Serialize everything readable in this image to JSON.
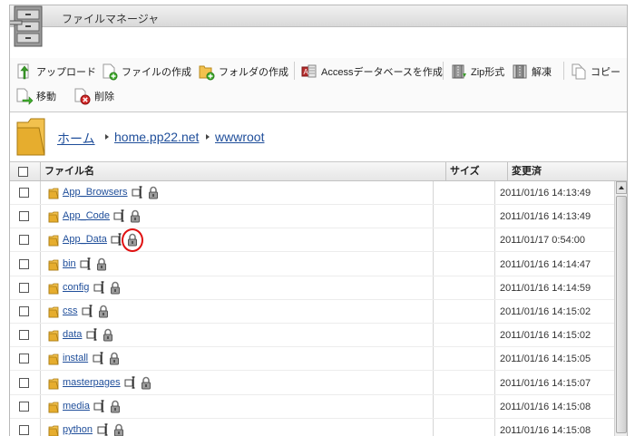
{
  "app": {
    "title": "ファイルマネージャ",
    "logo_icon": "file-cabinet-icon"
  },
  "toolbar": {
    "upload": "アップロード",
    "create_file": "ファイルの作成",
    "create_folder": "フォルダの作成",
    "create_access_db": "Accessデータベースを作成",
    "zip": "Zip形式",
    "extract": "解凍",
    "copy": "コピー",
    "move": "移動",
    "delete": "削除"
  },
  "breadcrumb": {
    "home": "ホーム",
    "domain": "home.pp22.net",
    "folder": "wwwroot"
  },
  "columns": {
    "name": "ファイル名",
    "size": "サイズ",
    "modified": "変更済"
  },
  "files": [
    {
      "name": "App_Browsers",
      "size": "",
      "modified": "2011/01/16 14:13:49"
    },
    {
      "name": "App_Code",
      "size": "",
      "modified": "2011/01/16 14:13:49"
    },
    {
      "name": "App_Data",
      "size": "",
      "modified": "2011/01/17 0:54:00"
    },
    {
      "name": "bin",
      "size": "",
      "modified": "2011/01/16 14:14:47"
    },
    {
      "name": "config",
      "size": "",
      "modified": "2011/01/16 14:14:59"
    },
    {
      "name": "css",
      "size": "",
      "modified": "2011/01/16 14:15:02"
    },
    {
      "name": "data",
      "size": "",
      "modified": "2011/01/16 14:15:02"
    },
    {
      "name": "install",
      "size": "",
      "modified": "2011/01/16 14:15:05"
    },
    {
      "name": "masterpages",
      "size": "",
      "modified": "2011/01/16 14:15:07"
    },
    {
      "name": "media",
      "size": "",
      "modified": "2011/01/16 14:15:08"
    },
    {
      "name": "python",
      "size": "",
      "modified": "2011/01/16 14:15:08"
    }
  ],
  "colors": {
    "link": "#1f4e9a",
    "highlight": "#e01010",
    "folder": "#f2c14e"
  }
}
